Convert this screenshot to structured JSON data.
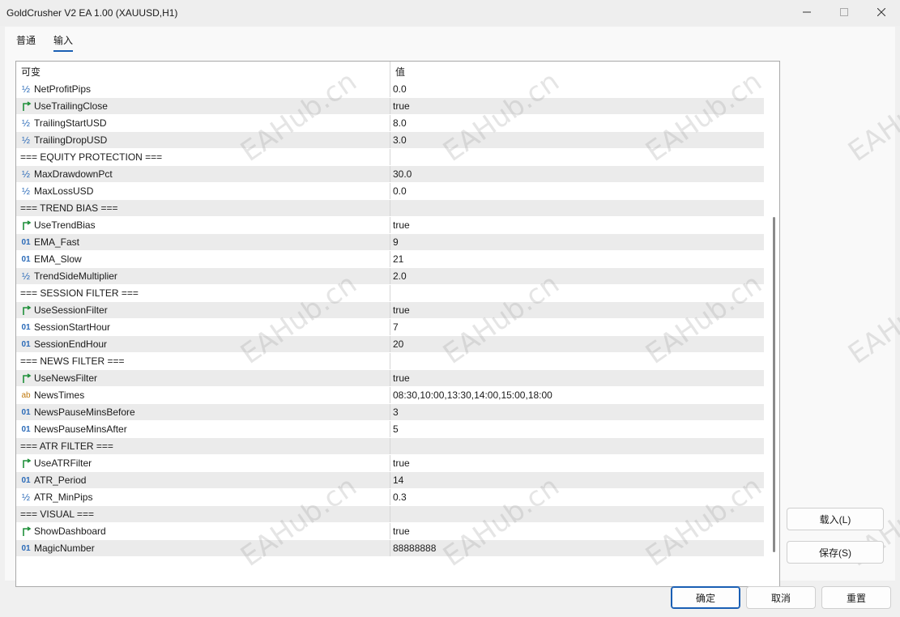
{
  "window": {
    "title": "GoldCrusher V2 EA 1.00 (XAUUSD,H1)"
  },
  "tabs": [
    {
      "label": "普通",
      "active": false
    },
    {
      "label": "输入",
      "active": true
    }
  ],
  "grid": {
    "col_variable": "可变",
    "col_value": "值",
    "rows": [
      {
        "icon": "fraction-icon",
        "name": "NetProfitPips",
        "value": "0.0"
      },
      {
        "icon": "bool-arrow-icon",
        "name": "UseTrailingClose",
        "value": "true"
      },
      {
        "icon": "fraction-icon",
        "name": "TrailingStartUSD",
        "value": "8.0"
      },
      {
        "icon": "fraction-icon",
        "name": "TrailingDropUSD",
        "value": "3.0"
      },
      {
        "icon": "",
        "name": "=== EQUITY PROTECTION ===",
        "value": ""
      },
      {
        "icon": "fraction-icon",
        "name": "MaxDrawdownPct",
        "value": "30.0"
      },
      {
        "icon": "fraction-icon",
        "name": "MaxLossUSD",
        "value": "0.0"
      },
      {
        "icon": "",
        "name": "=== TREND BIAS ===",
        "value": ""
      },
      {
        "icon": "bool-arrow-icon",
        "name": "UseTrendBias",
        "value": "true"
      },
      {
        "icon": "int-icon",
        "name": "EMA_Fast",
        "value": "9"
      },
      {
        "icon": "int-icon",
        "name": "EMA_Slow",
        "value": "21"
      },
      {
        "icon": "fraction-icon",
        "name": "TrendSideMultiplier",
        "value": "2.0"
      },
      {
        "icon": "",
        "name": "=== SESSION FILTER ===",
        "value": ""
      },
      {
        "icon": "bool-arrow-icon",
        "name": "UseSessionFilter",
        "value": "true"
      },
      {
        "icon": "int-icon",
        "name": "SessionStartHour",
        "value": "7"
      },
      {
        "icon": "int-icon",
        "name": "SessionEndHour",
        "value": "20"
      },
      {
        "icon": "",
        "name": "=== NEWS FILTER ===",
        "value": ""
      },
      {
        "icon": "bool-arrow-icon",
        "name": "UseNewsFilter",
        "value": "true"
      },
      {
        "icon": "string-icon",
        "name": "NewsTimes",
        "value": "08:30,10:00,13:30,14:00,15:00,18:00"
      },
      {
        "icon": "int-icon",
        "name": "NewsPauseMinsBefore",
        "value": "3"
      },
      {
        "icon": "int-icon",
        "name": "NewsPauseMinsAfter",
        "value": "5"
      },
      {
        "icon": "",
        "name": "=== ATR FILTER ===",
        "value": ""
      },
      {
        "icon": "bool-arrow-icon",
        "name": "UseATRFilter",
        "value": "true"
      },
      {
        "icon": "int-icon",
        "name": "ATR_Period",
        "value": "14"
      },
      {
        "icon": "fraction-icon",
        "name": "ATR_MinPips",
        "value": "0.3"
      },
      {
        "icon": "",
        "name": "=== VISUAL ===",
        "value": ""
      },
      {
        "icon": "bool-arrow-icon",
        "name": "ShowDashboard",
        "value": "true"
      },
      {
        "icon": "int-icon",
        "name": "MagicNumber",
        "value": "88888888"
      }
    ]
  },
  "icons": {
    "int_glyph": "01",
    "string_glyph": "ab",
    "fraction_glyph": "½"
  },
  "buttons": {
    "load": "载入(L)",
    "save": "保存(S)",
    "ok": "确定",
    "cancel": "取消",
    "reset": "重置"
  },
  "watermark": "EAHub.cn",
  "colors": {
    "accent": "#1a5fb4",
    "row_alt": "#ebebeb",
    "bool_icon": "#1f8f3a",
    "int_icon": "#2a6ab8",
    "string_icon": "#c07a10"
  }
}
